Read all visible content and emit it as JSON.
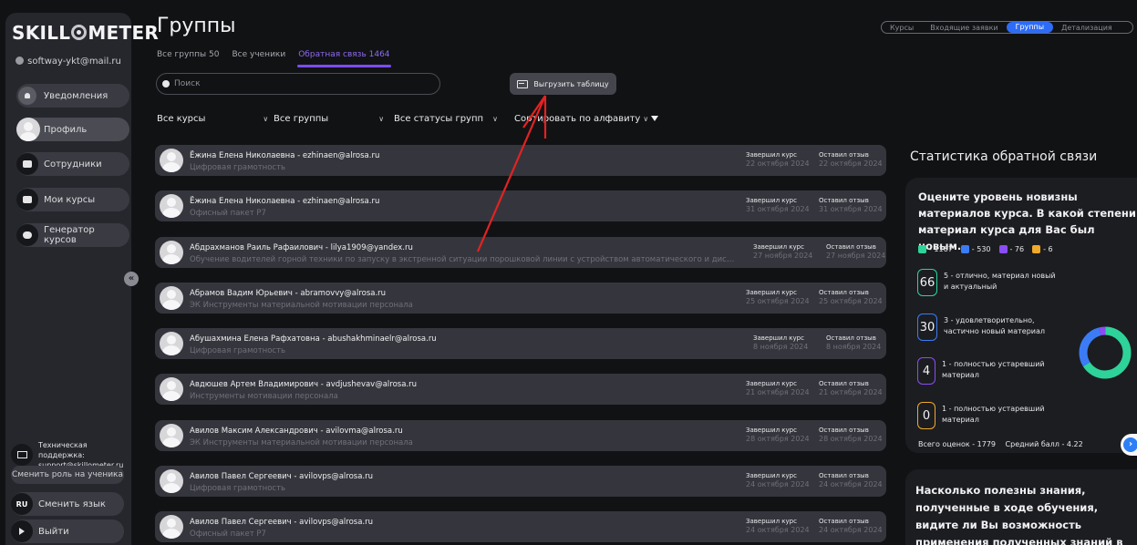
{
  "sidebar": {
    "logo_left": "SKILL",
    "logo_right": "METER",
    "user_email": "softway-ykt@mail.ru",
    "items": [
      {
        "label": "Уведомления"
      },
      {
        "label": "Профиль"
      },
      {
        "label": "Сотрудники"
      },
      {
        "label": "Мои курсы"
      },
      {
        "label": "Генератор курсов"
      }
    ],
    "support_label": "Техническая поддержка:",
    "support_email": "support@skillometer.ru",
    "switch_role": "Сменить роль на ученика",
    "lang_code": "RU",
    "switch_lang": "Сменить язык",
    "logout": "Выйти",
    "collapse_glyph": "«"
  },
  "header": {
    "title": "Группы",
    "tabs": [
      {
        "label": "Все группы 50"
      },
      {
        "label": "Все ученики"
      },
      {
        "label": "Обратная связь 1464"
      }
    ],
    "toggle": [
      "Курсы",
      "Входящие заявки",
      "Группы",
      "Детализация"
    ],
    "search_placeholder": "Поиск",
    "export_label": "Выгрузить таблицу",
    "filters": [
      "Все курсы",
      "Все группы",
      "Все статусы групп",
      "Сортировать по алфавиту"
    ]
  },
  "list_labels": {
    "finished": "Завершил курс",
    "review": "Оставил отзыв"
  },
  "rows": [
    {
      "name": "Ёжина Елена Николаевна - ezhinaen@alrosa.ru",
      "course": "Цифровая грамотность",
      "finished": "22 октября 2024",
      "review": "22 октября 2024"
    },
    {
      "name": "Ёжина Елена Николаевна - ezhinaen@alrosa.ru",
      "course": "Офисный пакет Р7",
      "finished": "31 октября 2024",
      "review": "31 октября 2024"
    },
    {
      "name": "Абдрахманов Раиль Рафаилович - lilya1909@yandex.ru",
      "course": "Обучение водителей горной техники по запуску в экстренной ситуации порошковой линии с устройством автоматического и дистанционно...",
      "finished": "27 ноября 2024",
      "review": "27 ноября 2024"
    },
    {
      "name": "Абрамов Вадим Юрьевич - abramovvy@alrosa.ru",
      "course": "ЭК Инструменты материальной мотивации персонала",
      "finished": "25 октября 2024",
      "review": "25 октября 2024"
    },
    {
      "name": "Абушахмина Елена Рафхатовна - abushakhminaelr@alrosa.ru",
      "course": "Цифровая грамотность",
      "finished": "8 ноября 2024",
      "review": "8 ноября 2024"
    },
    {
      "name": "Авдюшев Артем Владимирович - avdjushevav@alrosa.ru",
      "course": "Инструменты мотивации персонала",
      "finished": "21 октября 2024",
      "review": "21 октября 2024"
    },
    {
      "name": "Авилов Максим Александрович - avilovma@alrosa.ru",
      "course": "ЭК Инструменты материальной мотивации персонала",
      "finished": "28 октября 2024",
      "review": "28 октября 2024"
    },
    {
      "name": "Авилов Павел Сергеевич - avilovps@alrosa.ru",
      "course": "Цифровая грамотность",
      "finished": "24 октября 2024",
      "review": "24 октября 2024"
    },
    {
      "name": "Авилов Павел Сергеевич - avilovps@alrosa.ru",
      "course": "Офисный пакет Р7",
      "finished": "24 октября 2024",
      "review": "24 октября 2024"
    }
  ],
  "stats": {
    "title": "Статистика обратной связи",
    "question1": "Оцените уровень новизны материалов курса. В какой степени материал курса для Вас был новым.",
    "legend": [
      {
        "label": "- 1167",
        "color": "#2ed39a"
      },
      {
        "label": "- 530",
        "color": "#3b7cf6"
      },
      {
        "label": "- 76",
        "color": "#8a4df5"
      },
      {
        "label": "- 6",
        "color": "#f0a92a"
      }
    ],
    "scores": [
      {
        "value": "66",
        "label": "5 - отлично, материал новый и актуальный",
        "color": "#2ed39a"
      },
      {
        "value": "30",
        "label": "3 - удовлетворительно, частично новый материал",
        "color": "#3b7cf6"
      },
      {
        "value": "4",
        "label": "1 - полностью устаревший материал",
        "color": "#8a4df5"
      },
      {
        "value": "0",
        "label": "1 - полностью устаревший материал",
        "color": "#f0a92a"
      }
    ],
    "total": "Всего оценок - 1779",
    "avg": "Средний балл - 4.22",
    "question2": "Насколько полезны знания, полученные в ходе обучения, видите ли Вы возможность применения полученных знаний в рабочих процессах?",
    "donut_shares": [
      66,
      30,
      4,
      0
    ],
    "fab_glyph": "›"
  }
}
